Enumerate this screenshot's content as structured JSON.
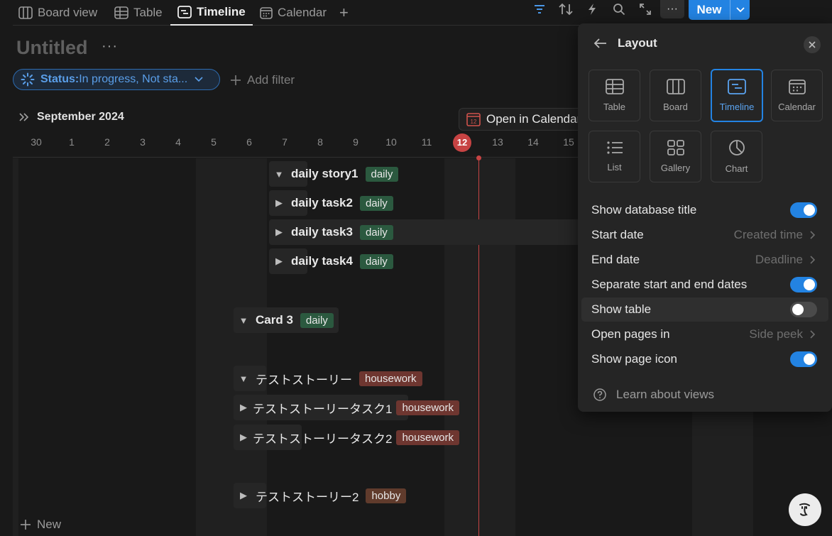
{
  "tabs": [
    {
      "label": "Board view",
      "icon": "board-icon"
    },
    {
      "label": "Table",
      "icon": "table-icon"
    },
    {
      "label": "Timeline",
      "icon": "timeline-icon",
      "active": true
    },
    {
      "label": "Calendar",
      "icon": "calendar-icon"
    }
  ],
  "toolbar": {
    "add_tab": "+",
    "more": "···",
    "new_label": "New"
  },
  "page": {
    "title": "Untitled",
    "title_more": "···"
  },
  "filters": {
    "status_key": "Status:",
    "status_value": " In progress, Not sta...",
    "add_filter": "Add filter"
  },
  "timeline": {
    "month": "September 2024",
    "days": [
      "30",
      "1",
      "2",
      "3",
      "4",
      "5",
      "6",
      "7",
      "8",
      "9",
      "10",
      "11",
      "12",
      "13",
      "14",
      "15"
    ],
    "today": "12",
    "open_in_calendar": "Open in Calendar",
    "calendar_icon_text": "12",
    "rows": [
      {
        "name": "daily story1",
        "tag": "daily",
        "tag_kind": "daily",
        "expanded": true
      },
      {
        "name": "daily task2",
        "tag": "daily",
        "tag_kind": "daily",
        "expanded": false
      },
      {
        "name": "daily task3",
        "tag": "daily",
        "tag_kind": "daily",
        "expanded": false
      },
      {
        "name": "daily task4",
        "tag": "daily",
        "tag_kind": "daily",
        "expanded": false
      },
      {
        "name": "Card 3",
        "tag": "daily",
        "tag_kind": "daily",
        "expanded": true
      },
      {
        "name": "テストストーリー",
        "tag": "housework",
        "tag_kind": "housework",
        "expanded": true
      },
      {
        "name": "テストストーリータスク1",
        "tag": "housework",
        "tag_kind": "housework",
        "expanded": false
      },
      {
        "name": "テストストーリータスク2",
        "tag": "housework",
        "tag_kind": "housework",
        "expanded": false
      },
      {
        "name": "テストストーリー2",
        "tag": "hobby",
        "tag_kind": "hobby",
        "expanded": false
      }
    ],
    "new_label": "New"
  },
  "layout_panel": {
    "title": "Layout",
    "layouts": [
      {
        "label": "Table",
        "icon": "table-icon"
      },
      {
        "label": "Board",
        "icon": "board-icon"
      },
      {
        "label": "Timeline",
        "icon": "timeline-icon",
        "active": true
      },
      {
        "label": "Calendar",
        "icon": "calendar-icon"
      },
      {
        "label": "List",
        "icon": "list-icon"
      },
      {
        "label": "Gallery",
        "icon": "gallery-icon"
      },
      {
        "label": "Chart",
        "icon": "chart-icon"
      }
    ],
    "settings": {
      "show_db_title": {
        "label": "Show database title",
        "on": true
      },
      "start_date": {
        "label": "Start date",
        "value": "Created time"
      },
      "end_date": {
        "label": "End date",
        "value": "Deadline"
      },
      "separate_dates": {
        "label": "Separate start and end dates",
        "on": true
      },
      "show_table": {
        "label": "Show table",
        "on": false
      },
      "open_pages_in": {
        "label": "Open pages in",
        "value": "Side peek"
      },
      "show_page_icon": {
        "label": "Show page icon",
        "on": true
      }
    },
    "learn": "Learn about views"
  },
  "colors": {
    "accent": "#2383e2",
    "today": "#c74343",
    "tag_daily": "#2b593f",
    "tag_housework": "#6e3630",
    "tag_hobby": "#603b2c",
    "background": "#191919",
    "panel": "#252525"
  }
}
